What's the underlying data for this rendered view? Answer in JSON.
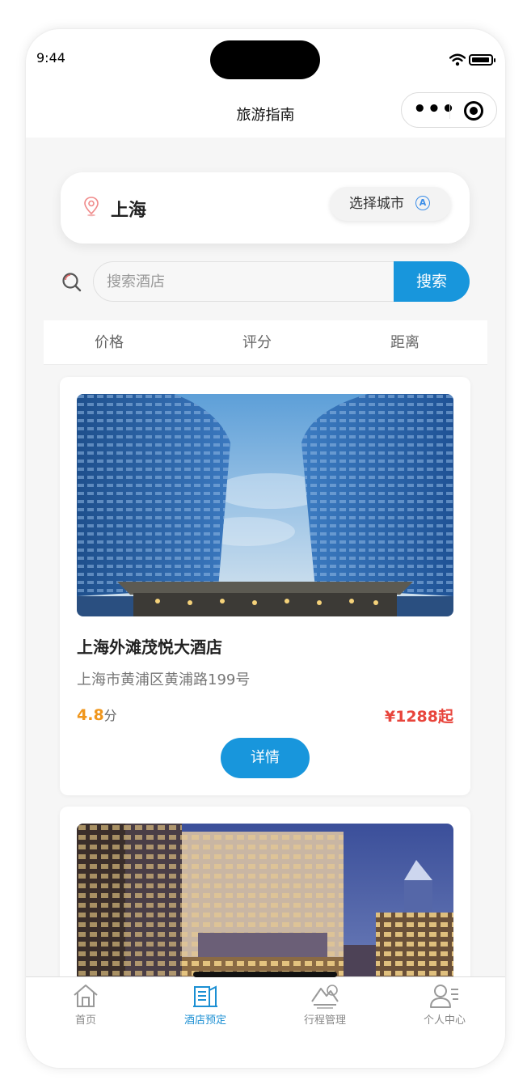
{
  "status_bar": {
    "time": "9:44"
  },
  "nav": {
    "title": "旅游指南"
  },
  "location": {
    "city": "上海",
    "select_city_label": "选择城市"
  },
  "search": {
    "placeholder": "搜索酒店",
    "button_label": "搜索"
  },
  "sort_tabs": [
    {
      "label": "价格"
    },
    {
      "label": "评分"
    },
    {
      "label": "距离"
    }
  ],
  "hotels": [
    {
      "name": "上海外滩茂悦大酒店",
      "address": "上海市黄浦区黄浦路199号",
      "rating": "4.8",
      "rating_unit": "分",
      "price": "¥1288起",
      "detail_label": "详情"
    },
    {
      "name": "",
      "address": "",
      "rating": "",
      "rating_unit": "",
      "price": "",
      "detail_label": ""
    }
  ],
  "tabbar": [
    {
      "label": "首页",
      "icon": "home-icon",
      "active": false
    },
    {
      "label": "酒店预定",
      "icon": "hotel-booking-icon",
      "active": true
    },
    {
      "label": "行程管理",
      "icon": "itinerary-icon",
      "active": false
    },
    {
      "label": "个人中心",
      "icon": "profile-icon",
      "active": false
    }
  ],
  "colors": {
    "primary": "#1896dc",
    "rating": "#f0961c",
    "price": "#e8453c"
  }
}
